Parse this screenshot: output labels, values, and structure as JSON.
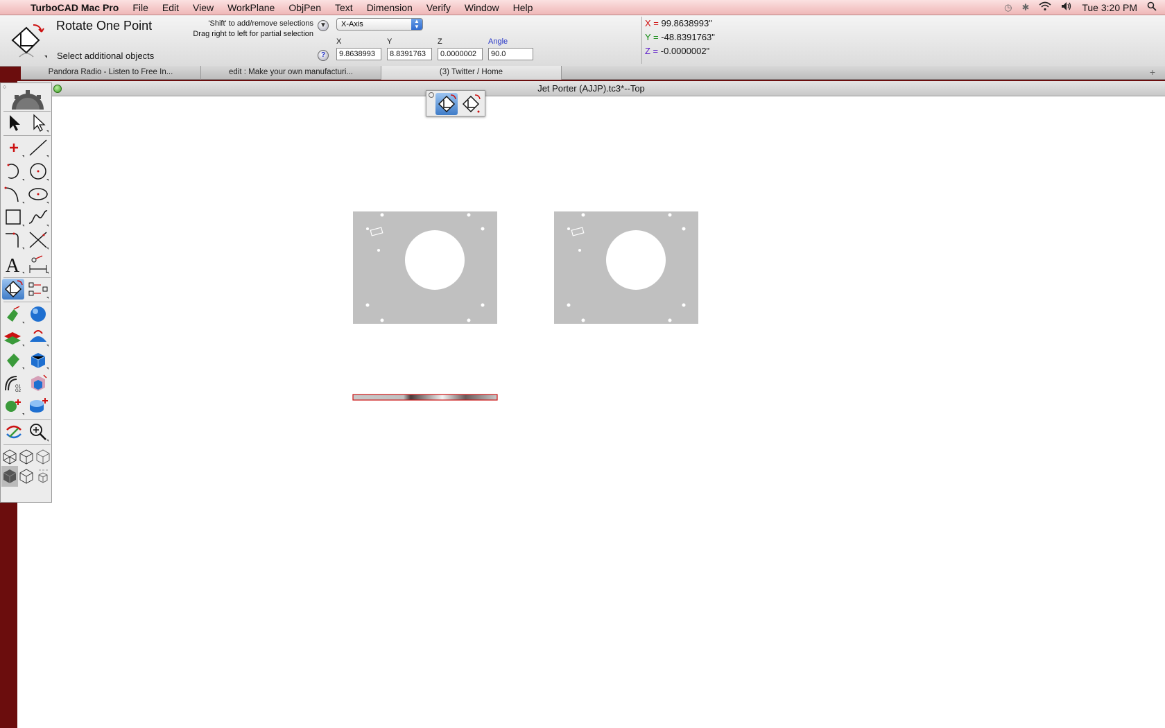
{
  "menubar": {
    "app_name": "TurboCAD Mac Pro",
    "items": [
      "File",
      "Edit",
      "View",
      "WorkPlane",
      "ObjPen",
      "Text",
      "Dimension",
      "Verify",
      "Window",
      "Help"
    ],
    "clock": "Tue 3:20 PM"
  },
  "toolbar": {
    "tool_title": "Rotate One Point",
    "prompt": "Select additional objects",
    "hint_line1": "'Shift' to add/remove selections",
    "hint_line2": "Drag right to left for partial selection",
    "axis_select": "X-Axis",
    "fields": {
      "x_label": "X",
      "x_value": "9.8638993",
      "y_label": "Y",
      "y_value": "8.8391763",
      "z_label": "Z",
      "z_value": "0.0000002",
      "angle_label": "Angle",
      "angle_value": "90.0"
    },
    "coords": {
      "x_label": "X =",
      "x_value": "99.8638993\"",
      "y_label": "Y =",
      "y_value": "-48.8391763\"",
      "z_label": "Z =",
      "z_value": "-0.0000002\""
    }
  },
  "tabs": [
    {
      "label": "Pandora Radio - Listen to Free In..."
    },
    {
      "label": "edit : Make your own manufacturi..."
    },
    {
      "label": "(3) Twitter / Home"
    }
  ],
  "document": {
    "title": "Jet Porter (AJJP).tc3*--Top"
  },
  "colors": {
    "panel_gray": "#c0c0c0",
    "selection_red": "#cc1111",
    "desktop": "#6b0d0d"
  }
}
